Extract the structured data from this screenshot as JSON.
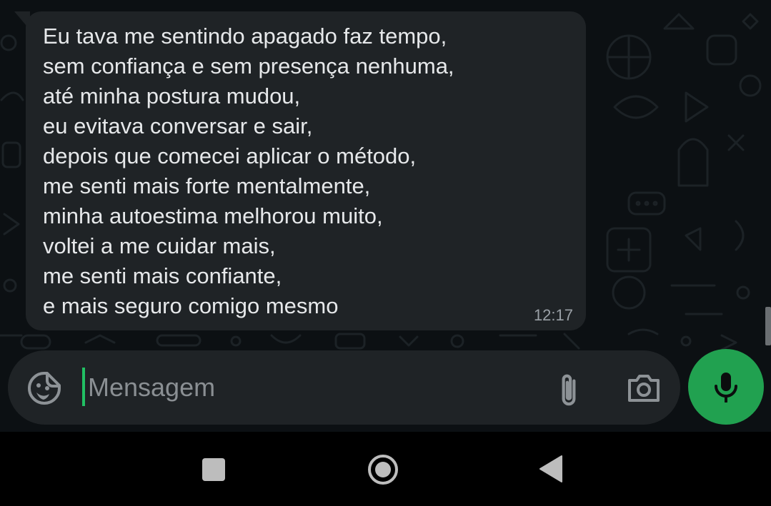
{
  "message": {
    "lines": [
      "Eu tava me sentindo apagado faz tempo,",
      "sem confiança e sem presença nenhuma,",
      "até minha postura mudou,",
      "eu evitava conversar e sair,",
      "depois que comecei aplicar o método,",
      "me senti mais forte mentalmente,",
      "minha autoestima melhorou muito,",
      "voltei a me cuidar mais,",
      "me senti mais confiante,",
      "e mais seguro comigo mesmo"
    ],
    "time": "12:17"
  },
  "composer": {
    "placeholder": "Mensagem",
    "value": ""
  },
  "icons": {
    "sticker": "sticker-icon",
    "attach": "paperclip-icon",
    "camera": "camera-icon",
    "mic": "microphone-icon",
    "nav_recents": "recents-icon",
    "nav_home": "home-icon",
    "nav_back": "back-icon"
  },
  "colors": {
    "bubble": "#1f2326",
    "accent": "#21a150",
    "cursor": "#21c063",
    "text": "#e6e8ea",
    "time": "#9aa0a6"
  }
}
